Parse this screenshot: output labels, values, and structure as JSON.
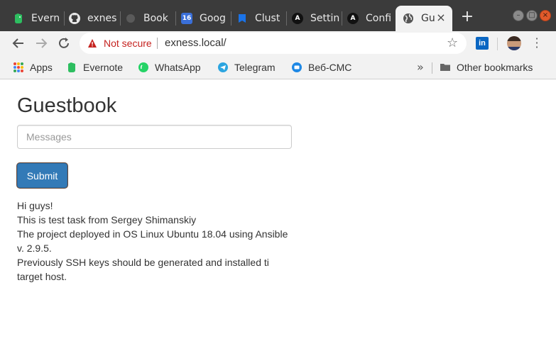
{
  "tabs": [
    {
      "label": "Evern",
      "icon": "evernote-icon"
    },
    {
      "label": "exnes",
      "icon": "github-icon"
    },
    {
      "label": "Book",
      "icon": "bookmark-icon"
    },
    {
      "label": "Goog",
      "icon": "google-calendar-icon",
      "badge": "16"
    },
    {
      "label": "Clust",
      "icon": "cluster-icon"
    },
    {
      "label": "Settin",
      "icon": "ansible-icon",
      "badge": "A"
    },
    {
      "label": "Confi",
      "icon": "ansible-icon",
      "badge": "A"
    },
    {
      "label": "Gu",
      "icon": "globe-icon",
      "active": true
    }
  ],
  "toolbar": {
    "security_label": "Not secure",
    "url": "exness.local/",
    "extension_badge": "in"
  },
  "bookmarks": {
    "items": [
      {
        "label": "Apps",
        "icon": "apps-icon"
      },
      {
        "label": "Evernote",
        "icon": "evernote-icon"
      },
      {
        "label": "WhatsApp",
        "icon": "whatsapp-icon"
      },
      {
        "label": "Telegram",
        "icon": "telegram-icon"
      },
      {
        "label": "Веб-СМС",
        "icon": "sms-icon"
      }
    ],
    "more": "»",
    "other_label": "Other bookmarks"
  },
  "page": {
    "title": "Guestbook",
    "input_placeholder": "Messages",
    "submit_label": "Submit",
    "messages": [
      "Hi guys!",
      "This is test task from Sergey Shimanskiy",
      "The project deployed in OS Linux Ubuntu 18.04 using Ansible v. 2.9.5.",
      "Previously SSH keys should be generated and installed ti target host."
    ]
  },
  "colors": {
    "accent": "#337ab7",
    "warning": "#c5221f",
    "tabstrip": "#3b3b3b",
    "toolbar": "#f2f2f2"
  }
}
